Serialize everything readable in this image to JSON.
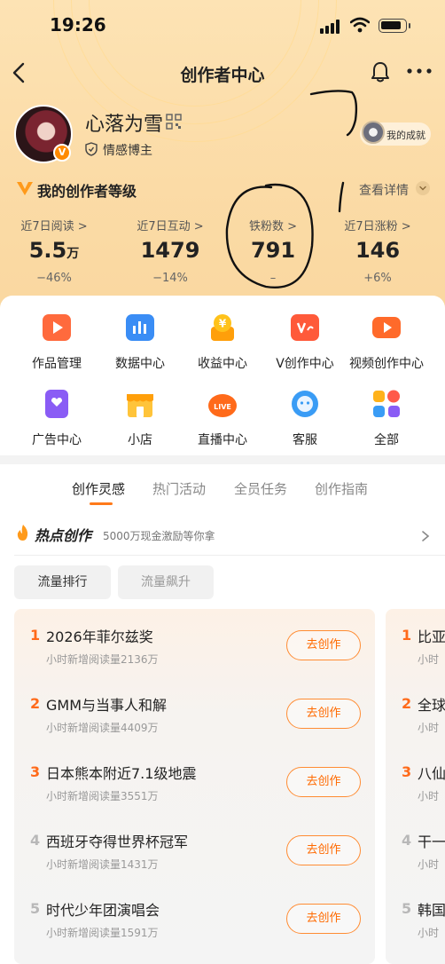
{
  "status": {
    "time": "19:26"
  },
  "nav": {
    "title": "创作者中心"
  },
  "profile": {
    "name": "心落为雪",
    "tag": "情感博主",
    "achievement": "我的成就"
  },
  "level": {
    "title": "我的创作者等级",
    "detail": "查看详情"
  },
  "stats": [
    {
      "label": "近7日阅读 >",
      "value": "5.5",
      "unit": "万",
      "change": "−46%"
    },
    {
      "label": "近7日互动 >",
      "value": "1479",
      "unit": "",
      "change": "−14%"
    },
    {
      "label": "铁粉数 >",
      "value": "791",
      "unit": "",
      "change": "–"
    },
    {
      "label": "近7日涨粉 >",
      "value": "146",
      "unit": "",
      "change": "+6%"
    }
  ],
  "tools": [
    {
      "label": "作品管理",
      "icon": "works-manage-icon",
      "color": "#ff6a3d"
    },
    {
      "label": "数据中心",
      "icon": "data-center-icon",
      "color": "#3a8df5"
    },
    {
      "label": "收益中心",
      "icon": "income-center-icon",
      "color": "#ffb200"
    },
    {
      "label": "V创作中心",
      "icon": "v-creation-icon",
      "color": "#ff5a3a"
    },
    {
      "label": "视频创作中心",
      "icon": "video-creation-icon",
      "color": "#ff6a2a"
    },
    {
      "label": "广告中心",
      "icon": "ad-center-icon",
      "color": "#8a5cf5"
    },
    {
      "label": "小店",
      "icon": "shop-icon",
      "color": "#ffb21a"
    },
    {
      "label": "直播中心",
      "icon": "live-center-icon",
      "color": "#ff6a1a"
    },
    {
      "label": "客服",
      "icon": "customer-service-icon",
      "color": "#3a9cf5"
    },
    {
      "label": "全部",
      "icon": "all-apps-icon",
      "color": "#ff5a4a"
    }
  ],
  "tabs": [
    "创作灵感",
    "热门活动",
    "全员任务",
    "创作指南"
  ],
  "hot": {
    "title": "热点创作",
    "subtitle": "5000万现金激励等你拿"
  },
  "chips": [
    "流量排行",
    "流量飙升"
  ],
  "ranking": [
    {
      "num": "1",
      "title": "2026年菲尔兹奖",
      "sub": "小时新增阅读量2136万",
      "action": "去创作"
    },
    {
      "num": "2",
      "title": "GMM与当事人和解",
      "sub": "小时新增阅读量4409万",
      "action": "去创作"
    },
    {
      "num": "3",
      "title": "日本熊本附近7.1级地震",
      "sub": "小时新增阅读量3551万",
      "action": "去创作"
    },
    {
      "num": "4",
      "title": "西班牙夺得世界杯冠军",
      "sub": "小时新增阅读量1431万",
      "action": "去创作"
    },
    {
      "num": "5",
      "title": "时代少年团演唱会",
      "sub": "小时新增阅读量1591万",
      "action": "去创作"
    }
  ],
  "ranking_next": [
    {
      "num": "1",
      "title": "比亚",
      "sub": "小时"
    },
    {
      "num": "2",
      "title": "全球",
      "sub": "小时"
    },
    {
      "num": "3",
      "title": "八仙",
      "sub": "小时"
    },
    {
      "num": "4",
      "title": "干一",
      "sub": "小时"
    },
    {
      "num": "5",
      "title": "韩国",
      "sub": "小时"
    }
  ],
  "colors": {
    "accent": "#ff6a00",
    "rank_top": "#ff6a1a",
    "rank_other": "#b8b8b8"
  }
}
